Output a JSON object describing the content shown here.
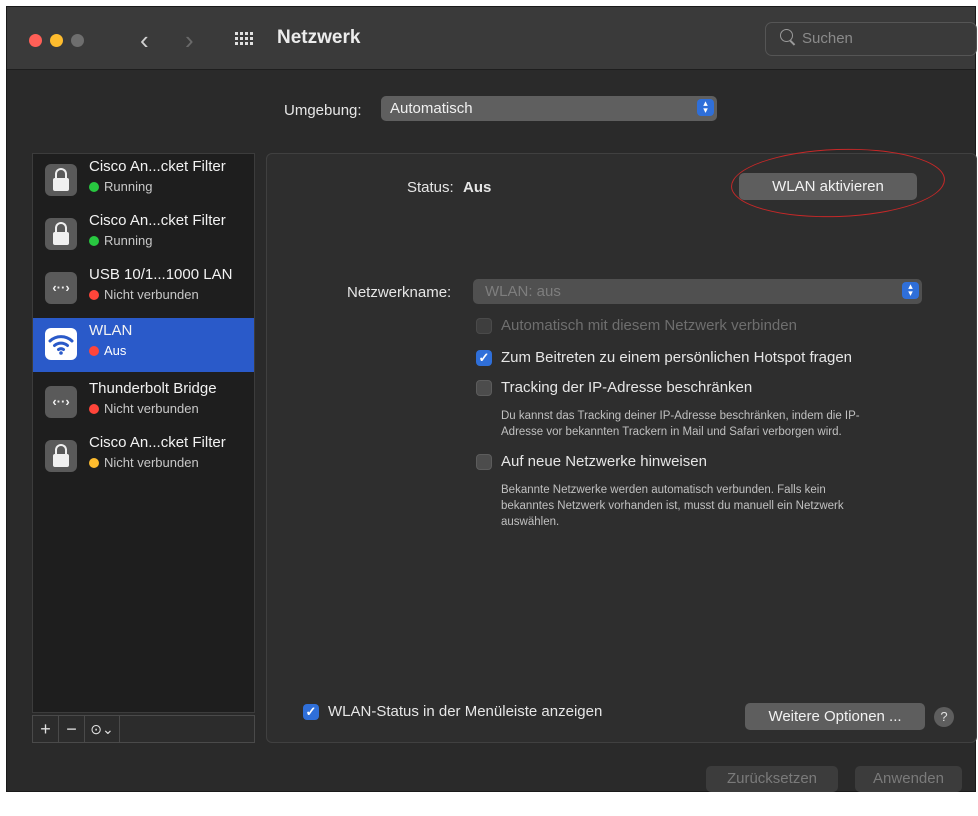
{
  "window": {
    "title": "Netzwerk",
    "nav_back": "‹",
    "nav_forward": "›",
    "search_placeholder": "Suchen",
    "colors": {
      "close": "#ff5f57",
      "minimize": "#febc2e",
      "zoom": "#6e6e6e",
      "accent": "#2f6fd9"
    }
  },
  "environment": {
    "label": "Umgebung:",
    "value": "Automatisch"
  },
  "services": [
    {
      "name": "Cisco An...cket Filter",
      "status": "Running",
      "status_color": "#28c840",
      "icon": "lock-icon"
    },
    {
      "name": "Cisco An...cket Filter",
      "status": "Running",
      "status_color": "#28c840",
      "icon": "lock-icon"
    },
    {
      "name": "USB 10/1...1000 LAN",
      "status": "Nicht verbunden",
      "status_color": "#ff453a",
      "icon": "ethernet-icon",
      "glyph": "‹··›"
    },
    {
      "name": "WLAN",
      "status": "Aus",
      "status_color": "#ff453a",
      "icon": "wifi-icon",
      "selected": true
    },
    {
      "name": "Thunderbolt Bridge",
      "status": "Nicht verbunden",
      "status_color": "#ff453a",
      "icon": "ethernet-icon",
      "glyph": "‹··›"
    },
    {
      "name": "Cisco An...cket Filter",
      "status": "Nicht verbunden",
      "status_color": "#febc2e",
      "icon": "lock-icon"
    }
  ],
  "sidebar_toolbar": {
    "add": "+",
    "remove": "−",
    "actions": "⊙⌄"
  },
  "detail": {
    "status_label": "Status:",
    "status_value": "Aus",
    "toggle_button": "WLAN aktivieren",
    "network_name_label": "Netzwerkname:",
    "network_name_value": "WLAN: aus",
    "options": [
      {
        "label": "Automatisch mit diesem Netzwerk verbinden",
        "checked": false,
        "disabled": true
      },
      {
        "label": "Zum Beitreten zu einem persönlichen Hotspot fragen",
        "checked": true
      },
      {
        "label": "Tracking der IP-Adresse beschränken",
        "checked": false,
        "description_1": "Du kannst das Tracking deiner IP-Adresse beschränken, indem die IP-",
        "description_2": "Adresse vor bekannten Trackern in Mail und Safari verborgen wird."
      },
      {
        "label": "Auf neue Netzwerke hinweisen",
        "checked": false,
        "description_1": "Bekannte Netzwerke werden automatisch verbunden. Falls kein",
        "description_2": "bekanntes Netzwerk vorhanden ist, musst du manuell ein Netzwerk",
        "description_3": "auswählen."
      }
    ],
    "menubar_checkbox": {
      "label": "WLAN-Status in der Menüleiste anzeigen",
      "checked": true
    },
    "more_options_button": "Weitere Optionen ...",
    "help_button": "?"
  },
  "footer": {
    "revert_button": "Zurücksetzen",
    "apply_button": "Anwenden"
  }
}
